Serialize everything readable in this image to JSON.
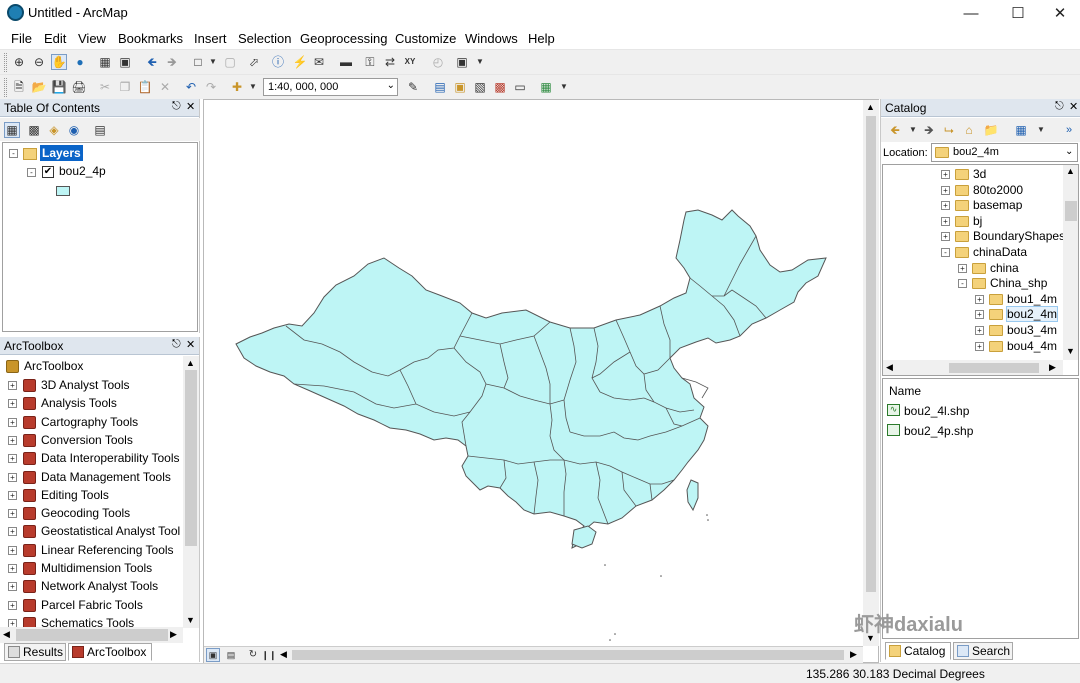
{
  "window": {
    "title": "Untitled - ArcMap"
  },
  "menu": [
    "File",
    "Edit",
    "View",
    "Bookmarks",
    "Insert",
    "Selection",
    "Geoprocessing",
    "Customize",
    "Windows",
    "Help"
  ],
  "toolbar": {
    "scale": "1:40, 000, 000"
  },
  "toc": {
    "title": "Table Of Contents",
    "layers_label": "Layers",
    "layer_name": "bou2_4p",
    "layer_checked": true,
    "symbol_color": "#bef5f5"
  },
  "arctoolbox": {
    "title": "ArcToolbox",
    "root": "ArcToolbox",
    "tools": [
      "3D Analyst Tools",
      "Analysis Tools",
      "Cartography Tools",
      "Conversion Tools",
      "Data Interoperability Tools",
      "Data Management Tools",
      "Editing Tools",
      "Geocoding Tools",
      "Geostatistical Analyst Tool",
      "Linear Referencing Tools",
      "Multidimension Tools",
      "Network Analyst Tools",
      "Parcel Fabric Tools",
      "Schematics Tools"
    ]
  },
  "bottom_tabs": {
    "results": "Results",
    "arctoolbox": "ArcToolbox"
  },
  "map": {
    "fill_color": "#bef5f5",
    "stroke_color": "#555555"
  },
  "catalog": {
    "title": "Catalog",
    "location_label": "Location:",
    "location_value": "bou2_4m",
    "tree": [
      {
        "label": "3d",
        "indent": 0,
        "expander": "+"
      },
      {
        "label": "80to2000",
        "indent": 0,
        "expander": "+"
      },
      {
        "label": "basemap",
        "indent": 0,
        "expander": "+"
      },
      {
        "label": "bj",
        "indent": 0,
        "expander": "+"
      },
      {
        "label": "BoundaryShapes",
        "indent": 0,
        "expander": "+"
      },
      {
        "label": "chinaData",
        "indent": 0,
        "expander": "-"
      },
      {
        "label": "china",
        "indent": 1,
        "expander": "+"
      },
      {
        "label": "China_shp",
        "indent": 1,
        "expander": "-"
      },
      {
        "label": "bou1_4m",
        "indent": 2,
        "expander": "+"
      },
      {
        "label": "bou2_4m",
        "indent": 2,
        "expander": "+",
        "selected": true
      },
      {
        "label": "bou3_4m",
        "indent": 2,
        "expander": "+"
      },
      {
        "label": "bou4_4m",
        "indent": 2,
        "expander": "+"
      }
    ],
    "list_header": "Name",
    "files": [
      {
        "name": "bou2_4l.shp",
        "icon": "line-shapefile-icon"
      },
      {
        "name": "bou2_4p.shp",
        "icon": "polygon-shapefile-icon"
      }
    ],
    "tab_catalog": "Catalog",
    "tab_search": "Search"
  },
  "status": {
    "x": "135.286",
    "y": "30.183",
    "units": "Decimal Degrees"
  },
  "watermark": "虾神daxialu"
}
